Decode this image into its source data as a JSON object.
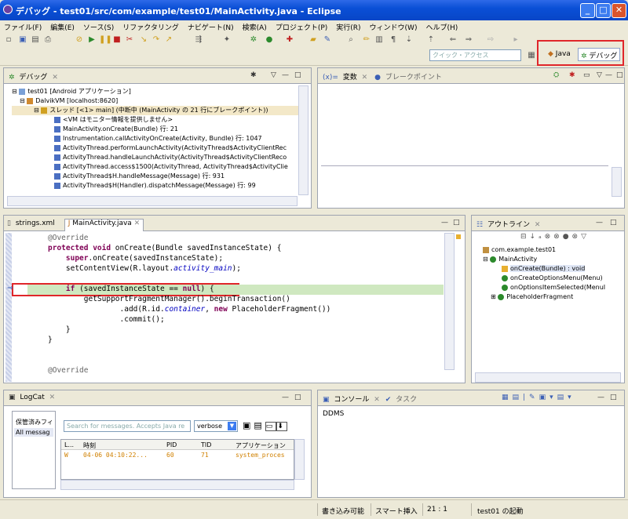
{
  "window": {
    "title": "デバッグ - test01/src/com/example/test01/MainActivity.java - Eclipse"
  },
  "menu": [
    "ファイル(F)",
    "編集(E)",
    "ソース(S)",
    "リファクタリング",
    "ナビゲート(N)",
    "検索(A)",
    "プロジェクト(P)",
    "実行(R)",
    "ウィンドウ(W)",
    "ヘルプ(H)"
  ],
  "toolbar": {
    "quick_access_placeholder": "クイック・アクセス"
  },
  "perspectives": {
    "java": "Java",
    "debug": "デバッグ"
  },
  "debug_view": {
    "tab": "デバッグ",
    "items": [
      "test01 [Android アプリケーション]",
      "DalvikVM [localhost:8620]",
      "スレッド [<1> main] (中断中 (MainActivity の 21 行にブレークポイント))",
      "<VM はモニター情報を提供しません>",
      "MainActivity.onCreate(Bundle) 行: 21",
      "Instrumentation.callActivityOnCreate(Activity, Bundle) 行: 1047",
      "ActivityThread.performLaunchActivity(ActivityThread$ActivityClientRec",
      "ActivityThread.handleLaunchActivity(ActivityThread$ActivityClientReco",
      "ActivityThread.access$1500(ActivityThread, ActivityThread$ActivityClie",
      "ActivityThread$H.handleMessage(Message) 行: 931",
      "ActivityThread$H(Handler).dispatchMessage(Message) 行: 99"
    ]
  },
  "variables_view": {
    "tab_variables": "変数",
    "tab_breakpoints": "ブレークポイント"
  },
  "editor": {
    "tab_strings": "strings.xml",
    "tab_main": "MainActivity.java"
  },
  "code": {
    "l1": "@Override",
    "l2_kw": "protected void",
    "l2": " onCreate(Bundle savedInstanceState) {",
    "l3_kw": "super",
    "l3": ".onCreate(savedInstanceState);",
    "l4a": "setContentView(R.layout.",
    "l4b": "activity_main",
    "l4c": ");",
    "l6_kw": "if",
    "l6": " (savedInstanceState == ",
    "l6_null": "null",
    "l6_end": ") {",
    "l7": "getSupportFragmentManager().beginTransaction()",
    "l8a": ".add(R.id.",
    "l8b": "container",
    "l8c": ", ",
    "l8_new": "new",
    "l8d": " PlaceholderFragment())",
    "l9": ".commit();",
    "l10": "}",
    "l11": "}",
    "l13": "@Override"
  },
  "outline": {
    "tab": "アウトライン",
    "items": [
      "com.example.test01",
      "MainActivity",
      "onCreate(Bundle) : void",
      "onCreateOptionsMenu(Menu)",
      "onOptionsItemSelected(MenuI",
      "PlaceholderFragment"
    ]
  },
  "logcat": {
    "tab": "LogCat",
    "saved_filters": "保管済みフィ",
    "all_messages": "All messag",
    "search_placeholder": "Search for messages. Accepts Java re",
    "level": "verbose",
    "columns": [
      "L...",
      "時刻",
      "PID",
      "TID",
      "アプリケーション"
    ],
    "rows": [
      [
        "W",
        "04-06 04:10:22...",
        "60",
        "71",
        "system_proces"
      ]
    ]
  },
  "console": {
    "tab_console": "コンソール",
    "tab_tasks": "タスク",
    "content": "DDMS"
  },
  "status": {
    "writable": "書き込み可能",
    "insert": "スマート挿入",
    "position": "21 : 1",
    "launch": "test01 の起動"
  },
  "colors": {
    "title": "#0a4fd6",
    "highlight": "#cfe8c0",
    "red_frame": "#e0262a"
  }
}
